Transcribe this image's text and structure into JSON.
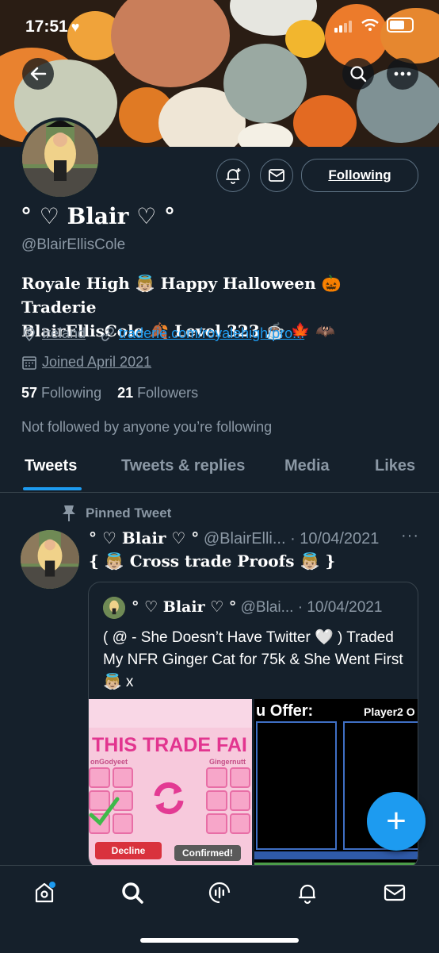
{
  "status": {
    "time": "17:51"
  },
  "profile": {
    "name": "° ♡ Blair ♡ °",
    "handle": "@BlairEllisCole",
    "bio_line1": "Royale High 👼🏼 Happy Halloween 🎃 Traderie",
    "bio_line2": "BlairEllisCole 🍂 Level 323 ☕️ 🍁 🦇",
    "location": "Ireland",
    "website": "traderie.com/royalehigh/pro...",
    "joined": "Joined April 2021",
    "following_count": "57",
    "following_label": "Following",
    "followers_count": "21",
    "followers_label": "Followers",
    "not_followed": "Not followed by anyone you’re following",
    "follow_button": "Following"
  },
  "tabs": [
    {
      "label": "Tweets"
    },
    {
      "label": "Tweets & replies"
    },
    {
      "label": "Media"
    },
    {
      "label": "Likes"
    }
  ],
  "tweet": {
    "pinned_label": "Pinned Tweet",
    "name": "° ♡ Blair ♡ °",
    "handle_date": "@BlairElli... · 10/04/2021",
    "more": "···",
    "text": "{ 👼🏼 Cross trade Proofs 👼🏼 }",
    "quote": {
      "name": "° ♡ Blair ♡ °",
      "handle_date": "@Blai... · 10/04/2021",
      "text": "( @ - She Doesn’t Have Twitter 🤍 ) Traded My NFR Ginger Cat for 75k & She Went First 👼🏼 x",
      "img1": {
        "banner": "THIS TRADE FAI",
        "left_user": "onGodyeet",
        "right_user": "Gingernutt",
        "decline": "Decline",
        "confirmed": "Confirmed!"
      },
      "img2": {
        "offer": "u Offer:",
        "player2": "Player2 O"
      }
    }
  },
  "fab": "+",
  "colors": {
    "bg": "#15202b",
    "accent": "#1d9bf0",
    "muted": "#8b98a5"
  },
  "icons": [
    "back-arrow-icon",
    "search-icon",
    "more-icon",
    "add-notification-icon",
    "message-icon",
    "location-icon",
    "link-icon",
    "calendar-icon",
    "pin-icon",
    "home-icon",
    "explore-icon",
    "spaces-icon",
    "notifications-icon",
    "messages-icon"
  ]
}
